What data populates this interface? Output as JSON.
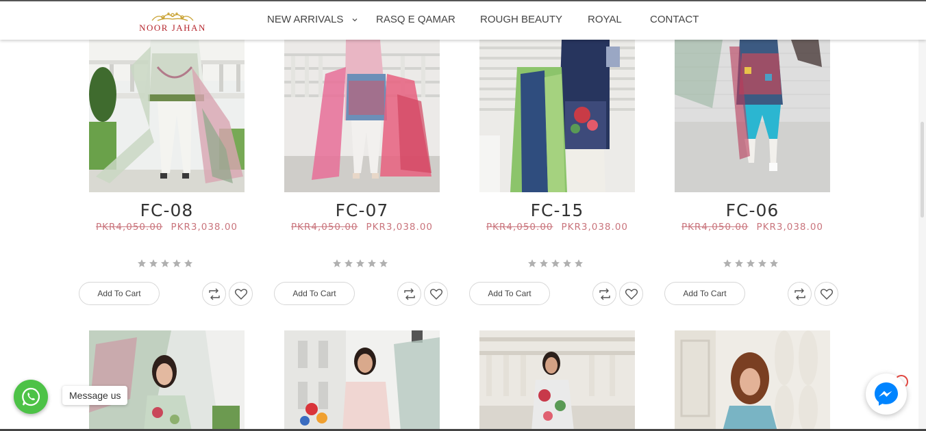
{
  "brand": {
    "logo_text": "NOOR JAHAN"
  },
  "nav": {
    "items": [
      {
        "label": "NEW ARRIVALS",
        "has_dropdown": true
      },
      {
        "label": "RASQ E QAMAR"
      },
      {
        "label": "ROUGH BEAUTY"
      },
      {
        "label": "ROYAL"
      },
      {
        "label": "CONTACT"
      }
    ]
  },
  "products": [
    {
      "title": "FC-08",
      "old_price": "PKR4,050.00",
      "price": "PKR3,038.00",
      "rating": 0,
      "cart_label": "Add To Cart"
    },
    {
      "title": "FC-07",
      "old_price": "PKR4,050.00",
      "price": "PKR3,038.00",
      "rating": 0,
      "cart_label": "Add To Cart"
    },
    {
      "title": "FC-15",
      "old_price": "PKR4,050.00",
      "price": "PKR3,038.00",
      "rating": 0,
      "cart_label": "Add To Cart"
    },
    {
      "title": "FC-06",
      "old_price": "PKR4,050.00",
      "price": "PKR3,038.00",
      "rating": 0,
      "cart_label": "Add To Cart"
    }
  ],
  "second_row_count": 4,
  "whatsapp": {
    "label": "Message us",
    "icon": "whatsapp-icon",
    "color": "#4dc247"
  },
  "messenger": {
    "icon": "messenger-icon",
    "color": "#0084ff"
  },
  "colors": {
    "price": "#c9747c",
    "logo": "#b5262d",
    "star": "#b0b0b0"
  }
}
